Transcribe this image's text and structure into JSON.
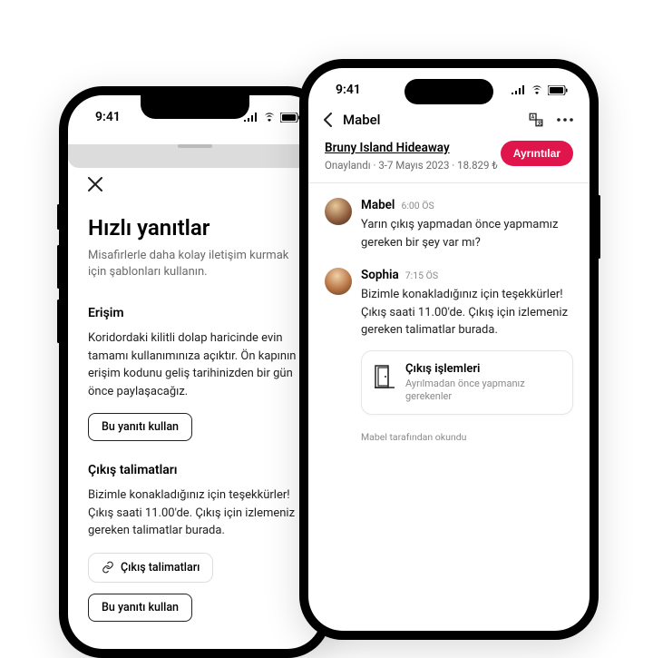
{
  "status": {
    "time": "9:41"
  },
  "left": {
    "title": "Hızlı yanıtlar",
    "subtitle": "Misafirlerle daha kolay iletişim kurmak için şablonları kullanın.",
    "section1": {
      "heading": "Erişim",
      "body": "Koridordaki kilitli dolap haricinde evin tamamı kullanımınıza açıktır. Ön kapının erişim kodunu geliş tarihinizden bir gün önce paylaşacağız."
    },
    "use_button": "Bu yanıtı kullan",
    "section2": {
      "heading": "Çıkış talimatları",
      "body": "Bizimle konakladığınız için teşekkürler! Çıkış saati 11.00'de. Çıkış için izlemeniz gereken talimatlar burada."
    },
    "link_chip": "Çıkış talimatları"
  },
  "right": {
    "nav_title": "Mabel",
    "listing": {
      "title": "Bruny Island Hideaway",
      "meta": "Onaylandı · 3-7 Mayıs 2023 · 18.829 ₺"
    },
    "details_button": "Ayrıntılar",
    "messages": [
      {
        "name": "Mabel",
        "time": "6:00 ÖS",
        "text": "Yarın çıkış yapmadan önce yapmamız gereken bir şey var mı?"
      },
      {
        "name": "Sophia",
        "time": "7:15 ÖS",
        "text": "Bizimle konakladığınız için teşekkürler! Çıkış saati 11.00'de. Çıkış için izlemeniz gereken talimatlar burada."
      }
    ],
    "card": {
      "title": "Çıkış işlemleri",
      "subtitle": "Ayrılmadan önce yapmanız gerekenler"
    },
    "read_receipt": "Mabel tarafından okundu"
  }
}
